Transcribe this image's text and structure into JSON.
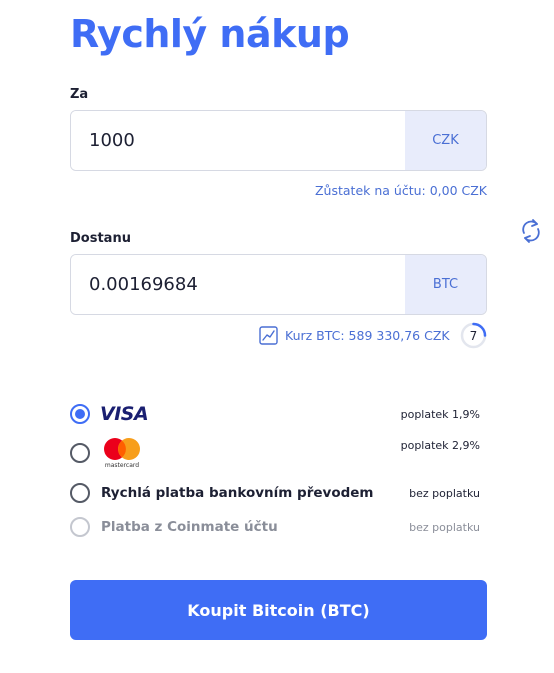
{
  "title": "Rychlý nákup",
  "pay": {
    "label": "Za",
    "value": "1000",
    "currency": "CZK",
    "balance": "Zůstatek na účtu: 0,00 CZK"
  },
  "receive": {
    "label": "Dostanu",
    "value": "0.00169684",
    "currency": "BTC",
    "rate": "Kurz BTC: 589 330,76 CZK",
    "timer": "7"
  },
  "methods": [
    {
      "name": "VISA",
      "fee": "poplatek 1,9%",
      "checked": true,
      "icon": "visa-logo"
    },
    {
      "name": "mastercard",
      "fee": "poplatek 2,9%",
      "checked": false,
      "icon": "mastercard-logo"
    },
    {
      "name": "Rychlá platba bankovním převodem",
      "fee": "bez poplatku",
      "checked": false
    },
    {
      "name": "Platba z Coinmate účtu",
      "fee": "bez poplatku",
      "checked": false,
      "disabled": true
    }
  ],
  "buy_button": "Koupit Bitcoin (BTC)",
  "colors": {
    "accent": "#3f6df5",
    "unit_bg": "#e8ecfb",
    "link": "#4a6fd4"
  }
}
